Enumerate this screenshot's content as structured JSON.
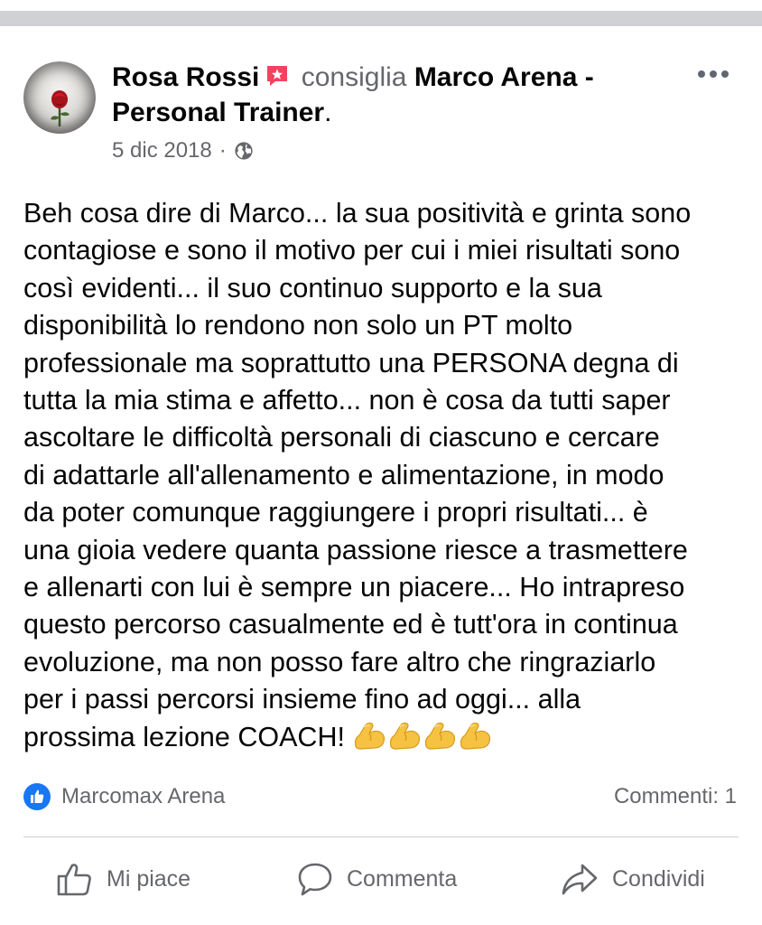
{
  "post": {
    "author": "Rosa Rossi",
    "verb": "consiglia",
    "page_line1": "Marco Arena -",
    "page_line2": "Personal Trainer",
    "page_end": ".",
    "date": "5 dic 2018",
    "meta_separator": "·",
    "audience_icon": "globe-icon",
    "recommend_icon": "recommend-icon",
    "more_icon": "more-dots-icon",
    "body": "Beh cosa dire di Marco... la sua positività e grinta sono\ncontagiose e sono il motivo per cui i miei risultati sono\ncosì evidenti... il suo continuo supporto e la sua\ndisponibilità lo rendono non solo un PT molto\nprofessionale ma soprattutto una PERSONA degna di\ntutta la mia stima e affetto... non è cosa da tutti saper\nascoltare le difficoltà personali di ciascuno e cercare\ndi adattarle all'allenamento e alimentazione, in modo\nda poter comunque raggiungere i propri risultati... è\nuna gioia vedere quanta passione riesce a trasmettere\ne allenarti con lui è sempre un piacere... Ho intrapreso\nquesto percorso casualmente ed è tutt'ora in continua\nevoluzione, ma non posso fare altro che ringraziarlo\nper i passi percorsi insieme fino ad oggi... alla\nprossima lezione COACH! ",
    "emoji_icon": "flexed-biceps-icon",
    "emoji_count": 4
  },
  "reactions": {
    "icon": "like-icon",
    "names": "Marcomax Arena",
    "comments": "Commenti: 1"
  },
  "actions": {
    "like": "Mi piace",
    "comment": "Commenta",
    "share": "Condividi"
  },
  "colors": {
    "text": "#050505",
    "secondary": "#65676b",
    "like_blue": "#1877f2",
    "recommend_red": "#f3425f",
    "divider": "#ced0d4"
  }
}
